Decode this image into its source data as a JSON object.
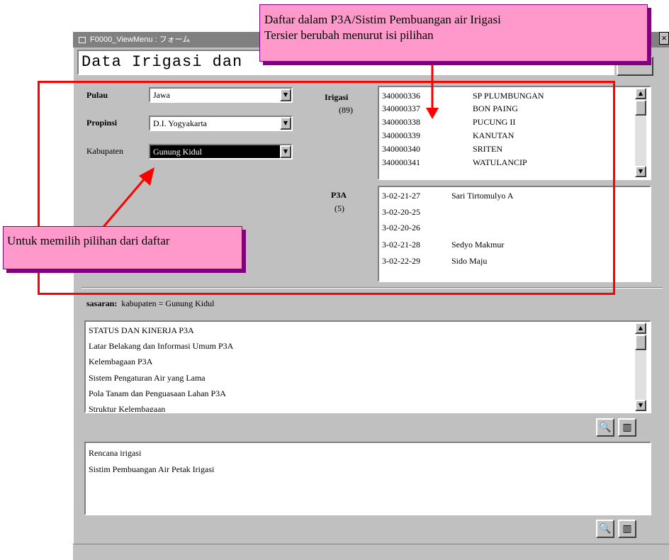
{
  "window": {
    "title": "F0000_ViewMenu : フォーム",
    "heading": "Data Irigasi dan"
  },
  "filters": {
    "pulau": {
      "label": "Pulau",
      "value": "Jawa"
    },
    "propinsi": {
      "label": "Propinsi",
      "value": "D.I. Yogyakarta"
    },
    "kabupaten": {
      "label": "Kabupaten",
      "value": "Gunung Kidul"
    }
  },
  "irigasi": {
    "label": "Irigasi",
    "count": "(89)",
    "rows": [
      {
        "code": "340000336",
        "name": "SP PLUMBUNGAN"
      },
      {
        "code": "340000337",
        "name": "BON PAING"
      },
      {
        "code": "340000338",
        "name": "PUCUNG II"
      },
      {
        "code": "340000339",
        "name": "KANUTAN"
      },
      {
        "code": "340000340",
        "name": "SRITEN"
      },
      {
        "code": "340000341",
        "name": "WATULANCIP"
      }
    ]
  },
  "p3a": {
    "label": "P3A",
    "count": "(5)",
    "rows": [
      {
        "code": "3-02-21-27",
        "name": "Sari Tirtomulyo A"
      },
      {
        "code": "3-02-20-25",
        "name": ""
      },
      {
        "code": "3-02-20-26",
        "name": ""
      },
      {
        "code": "3-02-21-28",
        "name": "Sedyo Makmur"
      },
      {
        "code": "3-02-22-29",
        "name": "Sido Maju"
      }
    ]
  },
  "sasaran": {
    "label": "sasaran:",
    "value": "kabupaten = Gunung Kidul"
  },
  "status_list": [
    "STATUS DAN KINERJA P3A",
    "Latar Belakang dan Informasi Umum P3A",
    "Kelembagaan P3A",
    "Sistem Pengaturan Air yang Lama",
    "Pola Tanam dan Penguasaan Lahan P3A",
    "Struktur Kelembagaan"
  ],
  "rencana_list": [
    "Rencana irigasi",
    "Sistim Pembuangan Air Petak Irigasi"
  ],
  "callouts": {
    "top_line1": "Daftar dalam P3A/Sistim Pembuangan air Irigasi",
    "top_line2": "Tersier berubah menurut isi pilihan",
    "left": "Untuk memilih pilihan dari daftar"
  },
  "icons": {
    "preview": "print-preview-icon",
    "form": "form-view-icon",
    "dropdown": "dropdown-arrow-icon"
  },
  "colors": {
    "annotation_red": "#ff0000",
    "callout_pink": "#ff99cc",
    "callout_shadow": "#800080",
    "window_gray": "#c0c0c0",
    "selected_bg": "#000000"
  }
}
